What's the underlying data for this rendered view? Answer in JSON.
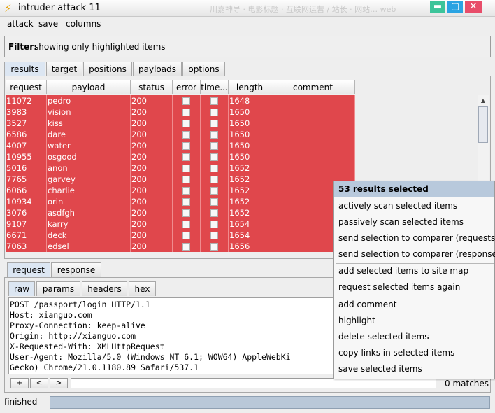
{
  "window": {
    "title": "intruder attack 11",
    "background_text": "川嘉神导 · 电影标题    ·  互联网运营 / 站长 · 网站…  web"
  },
  "menu": [
    "attack",
    "save",
    "columns"
  ],
  "filter": {
    "label": "Filter:",
    "text": "showing only highlighted items"
  },
  "tabs": [
    "results",
    "target",
    "positions",
    "payloads",
    "options"
  ],
  "table": {
    "columns": [
      "request",
      "payload",
      "status",
      "error",
      "time...",
      "length",
      "comment"
    ],
    "rows": [
      {
        "request": "11072",
        "payload": "pedro",
        "status": "200",
        "length": "1648"
      },
      {
        "request": "3983",
        "payload": "vision",
        "status": "200",
        "length": "1650"
      },
      {
        "request": "3527",
        "payload": "kiss",
        "status": "200",
        "length": "1650"
      },
      {
        "request": "6586",
        "payload": "dare",
        "status": "200",
        "length": "1650"
      },
      {
        "request": "4007",
        "payload": "water",
        "status": "200",
        "length": "1650"
      },
      {
        "request": "10955",
        "payload": "osgood",
        "status": "200",
        "length": "1650"
      },
      {
        "request": "5016",
        "payload": "anon",
        "status": "200",
        "length": "1652"
      },
      {
        "request": "7765",
        "payload": "garvey",
        "status": "200",
        "length": "1652"
      },
      {
        "request": "6066",
        "payload": "charlie",
        "status": "200",
        "length": "1652"
      },
      {
        "request": "10934",
        "payload": "orin",
        "status": "200",
        "length": "1652"
      },
      {
        "request": "3076",
        "payload": "asdfgh",
        "status": "200",
        "length": "1652"
      },
      {
        "request": "9107",
        "payload": "karry",
        "status": "200",
        "length": "1654"
      },
      {
        "request": "6671",
        "payload": "deck",
        "status": "200",
        "length": "1654"
      },
      {
        "request": "7063",
        "payload": "edsel",
        "status": "200",
        "length": "1656"
      }
    ],
    "row_color": "#e0474c"
  },
  "lower": {
    "tabs": [
      "request",
      "response"
    ],
    "subtabs": [
      "raw",
      "params",
      "headers",
      "hex"
    ],
    "code_lines": [
      "POST /passport/login HTTP/1.1",
      "Host: xianguo.com",
      "Proxy-Connection: keep-alive",
      "Origin: http://xianguo.com",
      "X-Requested-With: XMLHttpRequest",
      "User-Agent: Mozilla/5.0 (Windows NT 6.1; WOW64) AppleWebKi",
      "Gecko) Chrome/21.0.1180.89 Safari/537.1"
    ],
    "nav_buttons": [
      "+",
      "<",
      ">"
    ],
    "matches": "0 matches"
  },
  "status": {
    "text": "finished"
  },
  "context_menu": {
    "header": "53 results selected",
    "groups": [
      [
        "actively scan selected items",
        "passively scan selected items",
        "send selection to comparer (requests)",
        "send selection to comparer (responses)"
      ],
      [
        "add selected items to site map",
        "request selected items again"
      ],
      [
        "add comment",
        "highlight",
        "delete selected items",
        "copy links in selected items",
        "save selected items"
      ]
    ]
  }
}
